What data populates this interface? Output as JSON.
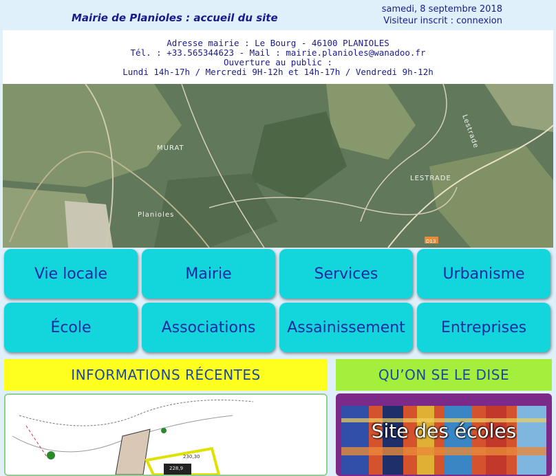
{
  "header": {
    "title": "Mairie de Planioles : accueil du site",
    "date": "samedi, 8 septembre 2018",
    "visitor_prefix": "Visiteur inscrit :",
    "login_link": "connexion"
  },
  "address": {
    "line1": "Adresse mairie : Le Bourg - 46100 PLANIOLES",
    "line2": "Tél. : +33.565344623 - Mail : mairie.planioles@wanadoo.fr",
    "line3": "Ouverture au public :",
    "line4": "Lundi 14h-17h / Mercredi 9H-12h et 14h-17h / Vendredi 9h-12h"
  },
  "map": {
    "labels": [
      "MURAT",
      "LESTRADE",
      "Planioles",
      "Lestrade",
      "D13"
    ]
  },
  "nav": {
    "items": [
      {
        "label": "Vie locale"
      },
      {
        "label": "Mairie"
      },
      {
        "label": "Services"
      },
      {
        "label": "Urbanisme"
      },
      {
        "label": "École"
      },
      {
        "label": "Associations"
      },
      {
        "label": "Assainissement"
      },
      {
        "label": "Entreprises"
      }
    ]
  },
  "sections": {
    "info_title": "INFORMATIONS RÉCENTES",
    "dise_title": "QU’ON SE LE DISE",
    "plan_labels": [
      "230,30",
      "228,9"
    ],
    "ecoles_title": "Site des écoles"
  },
  "colors": {
    "nav_button": "#12d6db",
    "nav_text": "#1a2aa0",
    "info_header": "#ffff1e",
    "dise_header": "#a3ef3c",
    "title_text": "#1a1a8c"
  }
}
